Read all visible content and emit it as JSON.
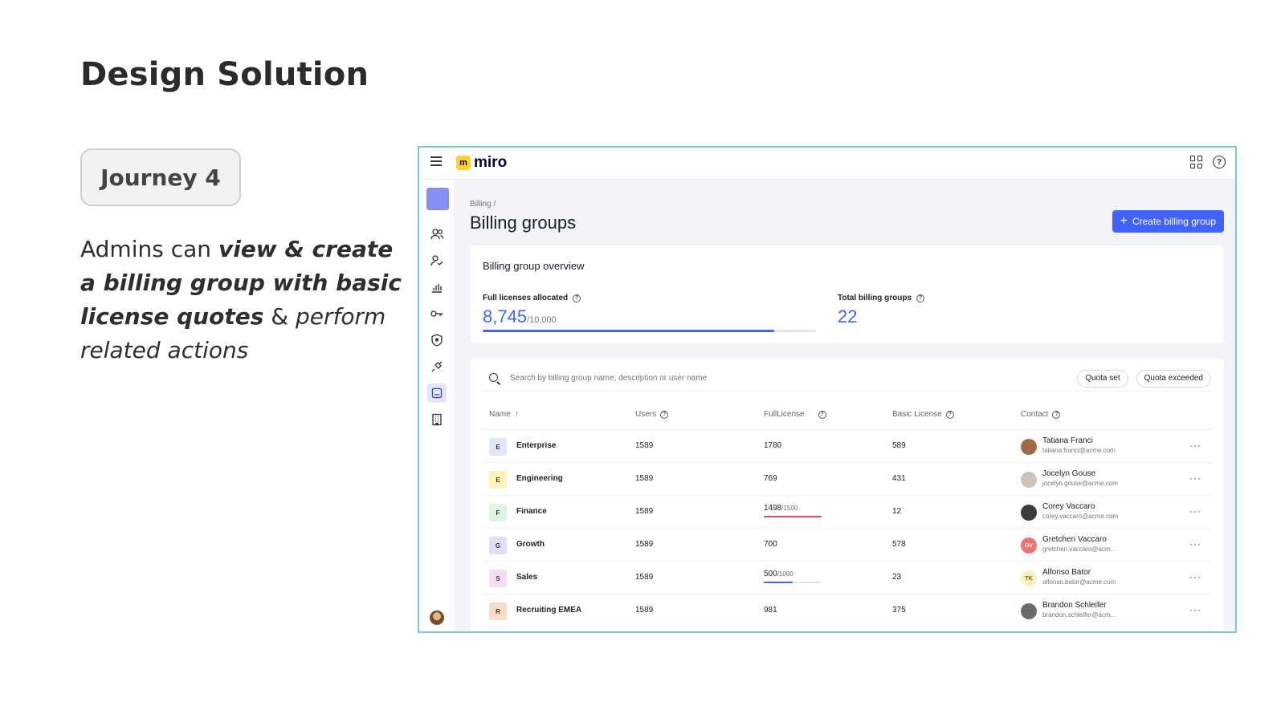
{
  "slide": {
    "title": "Design Solution",
    "journey": "Journey 4",
    "desc": {
      "p1": "Admins can ",
      "p2": "view & create a billing group with basic license quotes",
      "p3": " & ",
      "p4": "perform related actions"
    }
  },
  "app": {
    "logo_mark": "m",
    "logo_text": "miro",
    "breadcrumb": "Billing /",
    "page_title": "Billing groups",
    "create_button": "Create billing group",
    "icons": {
      "top": [
        "menu-icon",
        "apps-grid-icon",
        "help-icon"
      ],
      "sidebar": [
        "users-icon",
        "user-check-icon",
        "analytics-icon",
        "key-icon",
        "shield-icon",
        "plug-icon",
        "billing-icon",
        "building-icon"
      ]
    },
    "colors": {
      "accent": "#4262ff",
      "frame": "#7cc8d4",
      "over_quota": "#e5484d"
    },
    "overview": {
      "title": "Billing group overview",
      "licenses_label": "Full licenses allocated",
      "licenses_value": "8,745",
      "licenses_total": "/10,000",
      "licenses_fraction": 0.8745,
      "groups_label": "Total billing groups",
      "groups_value": "22"
    },
    "search_placeholder": "Search by billing group name, description or user name",
    "filters": [
      "Quota set",
      "Quota exceeded"
    ],
    "columns": {
      "name": "Name",
      "users": "Users",
      "full": "FullLicense",
      "basic": "Basic License",
      "contact": "Contact"
    },
    "rows": [
      {
        "initial": "E",
        "badge_color": "#dfe6fc",
        "name": "Enterprise",
        "users": "1589",
        "full": "1780",
        "basic": "589",
        "contact_name": "Tatiana Franci",
        "contact_email": "tatiana.franci@acme.com",
        "avatar_initials": "",
        "avatar_color": "#a0694a"
      },
      {
        "initial": "E",
        "badge_color": "#fbf3b8",
        "name": "Engineering",
        "users": "1589",
        "full": "769",
        "basic": "431",
        "contact_name": "Jocelyn Gouse",
        "contact_email": "jocelyn.gouse@acme.com",
        "avatar_initials": "",
        "avatar_color": "#cfc3b6"
      },
      {
        "initial": "F",
        "badge_color": "#dff5e4",
        "name": "Finance",
        "users": "1589",
        "full": "1498",
        "full_total": "/1500",
        "full_fraction": 0.999,
        "full_bar_color": "#e5484d",
        "basic": "12",
        "contact_name": "Corey Vaccaro",
        "contact_email": "corey.vaccaro@acme.com",
        "avatar_initials": "",
        "avatar_color": "#3b3b3b"
      },
      {
        "initial": "G",
        "badge_color": "#e0e0fb",
        "name": "Growth",
        "users": "1589",
        "full": "700",
        "basic": "578",
        "contact_name": "Gretchen Vaccaro",
        "contact_email": "gretchen.vaccaro@acm...",
        "avatar_initials": "GV",
        "avatar_color": "#f47171"
      },
      {
        "initial": "S",
        "badge_color": "#f6dcf5",
        "name": "Sales",
        "users": "1589",
        "full": "500",
        "full_total": "/1000",
        "full_fraction": 0.5,
        "full_bar_color": "#4262ff",
        "basic": "23",
        "contact_name": "Alfonso Bator",
        "contact_email": "alfonso.bator@acme.com",
        "avatar_initials": "TK",
        "avatar_color": "#fbf0c0"
      },
      {
        "initial": "R",
        "badge_color": "#fbdcc7",
        "name": "Recruiting EMEA",
        "users": "1589",
        "full": "981",
        "basic": "375",
        "contact_name": "Brandon Schleifer",
        "contact_email": "brandon.schleifer@acm...",
        "avatar_initials": "",
        "avatar_color": "#6b6b6b"
      }
    ]
  }
}
